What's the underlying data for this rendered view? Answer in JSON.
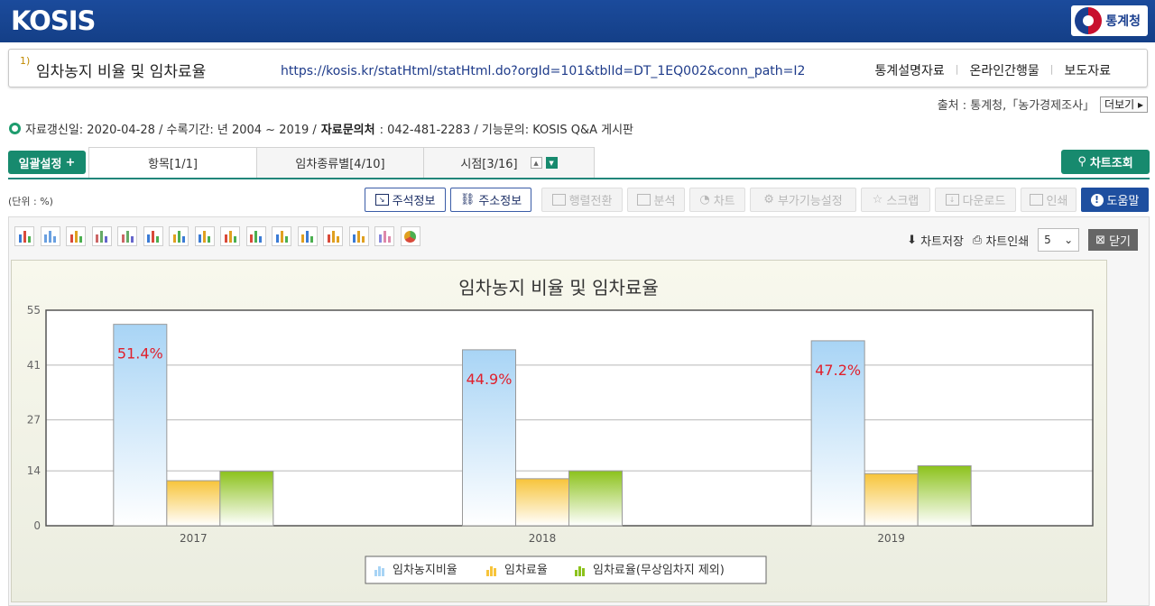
{
  "header": {
    "logo": "KOSIS",
    "agency": "통계청"
  },
  "title_box": {
    "number": "1)",
    "title": "임차농지 비율 및 임차료율",
    "url": "https://kosis.kr/statHtml/statHtml.do?orgId=101&tblId=DT_1EQ002&conn_path=I2",
    "links": [
      "통계설명자료",
      "온라인간행물",
      "보도자료"
    ]
  },
  "source": {
    "text": "출처 : 통계청,「농가경제조사」",
    "more_label": "더보기"
  },
  "info": {
    "updated": "자료갱신일: 2020-04-28 / 수록기간: 년 2004 ~ 2019 /",
    "contact_label": "자료문의처",
    "contact": ": 042-481-2283 / 기능문의: KOSIS Q&A 게시판"
  },
  "tabs": {
    "bulk_setting": "일괄설정",
    "items": [
      "항목[1/1]",
      "임차종류별[4/10]",
      "시점[3/16]"
    ],
    "chart_lookup": "차트조회"
  },
  "toolbar": {
    "unit": "(단위 : %)",
    "buttons": [
      "주석정보",
      "주소정보",
      "행렬전환",
      "분석",
      "차트",
      "부가기능설정",
      "스크랩",
      "다운로드",
      "인쇄",
      "도움말"
    ]
  },
  "chart_panel": {
    "save_label": "차트저장",
    "print_label": "차트인쇄",
    "count_value": "5",
    "close_label": "닫기"
  },
  "chart_data": {
    "type": "bar",
    "title": "임차농지 비율 및 임차료율",
    "categories": [
      "2017",
      "2018",
      "2019"
    ],
    "series": [
      {
        "name": "임차농지비율",
        "values": [
          51.4,
          44.9,
          47.2
        ],
        "color": "#a8d4f5",
        "labels": [
          "51.4%",
          "44.9%",
          "47.2%"
        ]
      },
      {
        "name": "임차료율",
        "values": [
          11.5,
          12.0,
          13.3
        ],
        "color": "#f7c43a"
      },
      {
        "name": "임차료율(무상임차지 제외)",
        "values": [
          13.9,
          14.0,
          15.3
        ],
        "color": "#8cc21c"
      }
    ],
    "yticks": [
      0,
      14,
      27,
      41,
      55
    ],
    "ylim": [
      0,
      55
    ],
    "label_color": "#e0202c",
    "legend": "bottom-center"
  }
}
